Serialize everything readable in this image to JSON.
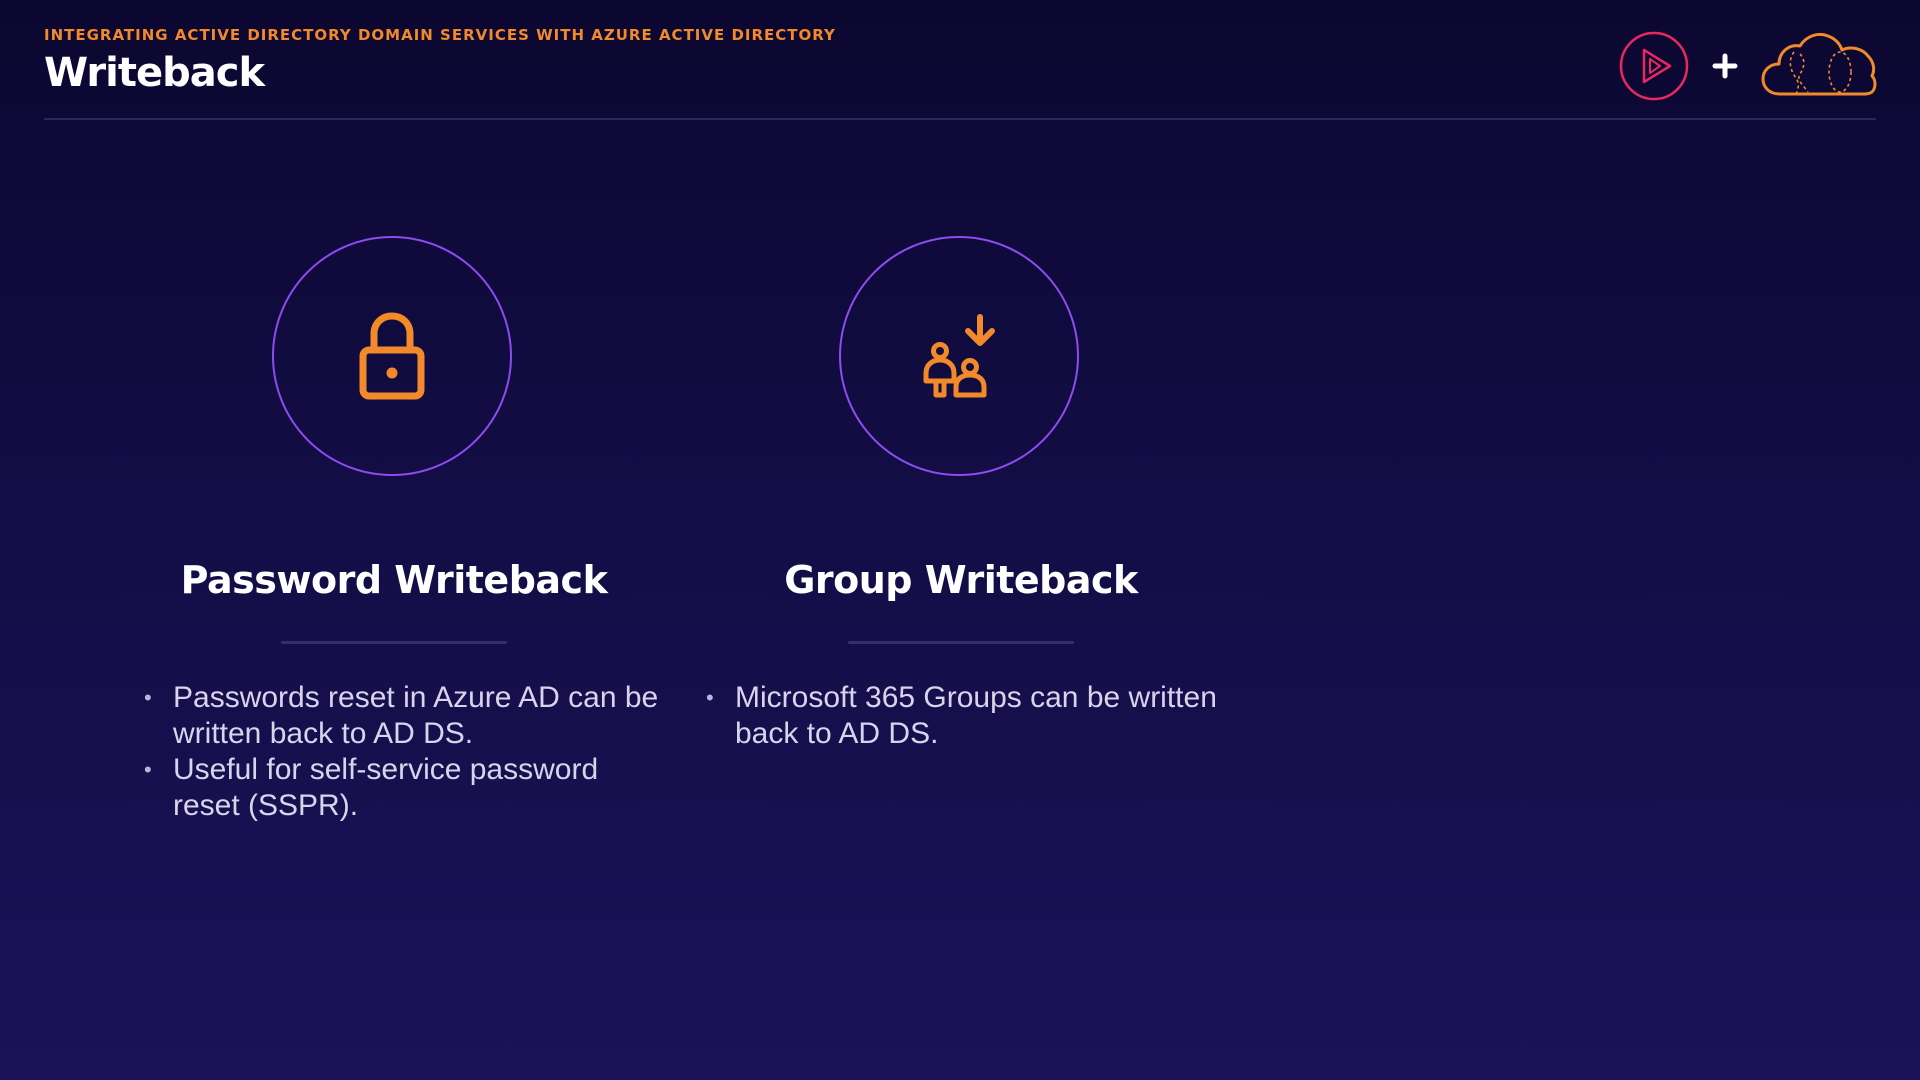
{
  "slide": {
    "eyebrow": "INTEGRATING ACTIVE DIRECTORY DOMAIN SERVICES WITH AZURE ACTIVE DIRECTORY",
    "title": "Writeback"
  },
  "logos": {
    "left": "play-logo-icon",
    "separator": "plus-icon",
    "right": "cloud-logo-icon"
  },
  "cards": [
    {
      "icon": "padlock-icon",
      "title": "Password Writeback",
      "bullets": [
        "Passwords reset in Azure AD can be written back to AD DS.",
        "Useful for self-service password reset (SSPR)."
      ]
    },
    {
      "icon": "group-download-icon",
      "title": "Group Writeback",
      "bullets": [
        "Microsoft 365 Groups can be written back to AD DS."
      ]
    }
  ],
  "colors": {
    "accent_orange": "#f2892b",
    "circle_purple": "#8b4cf0",
    "logo_red": "#e8285f",
    "background_top": "#0b0730",
    "background_bottom": "#1b1258"
  }
}
